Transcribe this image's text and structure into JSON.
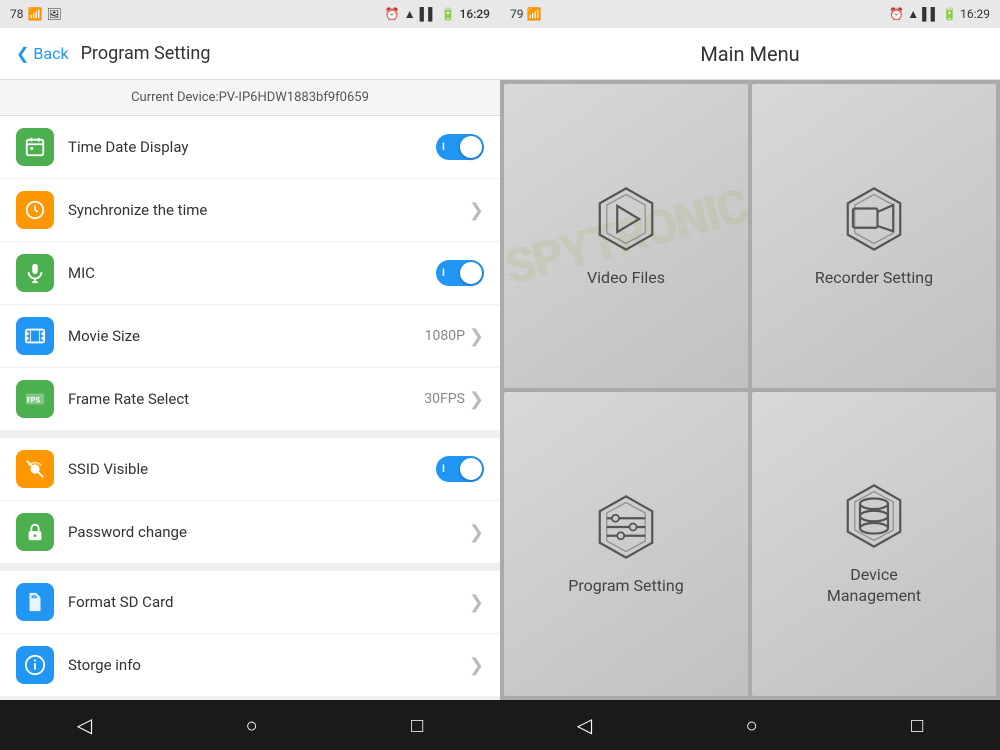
{
  "left": {
    "status_bar": {
      "left": "78",
      "time": "16:29",
      "battery": "100%"
    },
    "app_bar": {
      "back_label": "Back",
      "title": "Program Setting"
    },
    "device_info": "Current Device:PV-IP6HDW1883bf9f0659",
    "settings_sections": [
      {
        "id": "section1",
        "items": [
          {
            "id": "time-date",
            "label": "Time Date Display",
            "icon_type": "green",
            "icon": "calendar",
            "control": "toggle"
          },
          {
            "id": "sync-time",
            "label": "Synchronize the time",
            "icon_type": "orange",
            "icon": "clock",
            "control": "chevron"
          },
          {
            "id": "mic",
            "label": "MIC",
            "icon_type": "green",
            "icon": "mic",
            "control": "toggle"
          },
          {
            "id": "movie-size",
            "label": "Movie Size",
            "icon_type": "blue",
            "icon": "film",
            "control": "value",
            "value": "1080P"
          },
          {
            "id": "frame-rate",
            "label": "Frame Rate Select",
            "icon_type": "green",
            "icon": "fps",
            "control": "value",
            "value": "30FPS"
          }
        ]
      },
      {
        "id": "section2",
        "items": [
          {
            "id": "ssid",
            "label": "SSID Visible",
            "icon_type": "orange",
            "icon": "wifi-slash",
            "control": "toggle"
          },
          {
            "id": "password",
            "label": "Password change",
            "icon_type": "green",
            "icon": "lock",
            "control": "chevron"
          }
        ]
      },
      {
        "id": "section3",
        "items": [
          {
            "id": "format-sd",
            "label": "Format SD Card",
            "icon_type": "blue",
            "icon": "sd-card",
            "control": "chevron"
          },
          {
            "id": "storage",
            "label": "Storge info",
            "icon_type": "blue",
            "icon": "info",
            "control": "chevron"
          }
        ]
      }
    ],
    "nav": {
      "back": "◁",
      "home": "○",
      "recent": "□"
    }
  },
  "right": {
    "status_bar": {
      "left": "79",
      "time": "16:29"
    },
    "title": "Main Menu",
    "tiles": [
      {
        "id": "video-files",
        "label": "Video Files",
        "icon": "play"
      },
      {
        "id": "recorder-setting",
        "label": "Recorder Setting",
        "icon": "video-camera"
      },
      {
        "id": "program-setting",
        "label": "Program Setting",
        "icon": "sliders"
      },
      {
        "id": "device-management",
        "label": "Device\nManagement",
        "icon": "database"
      }
    ],
    "watermark": "SPYTRONIC",
    "nav": {
      "back": "◁",
      "home": "○",
      "recent": "□"
    }
  }
}
